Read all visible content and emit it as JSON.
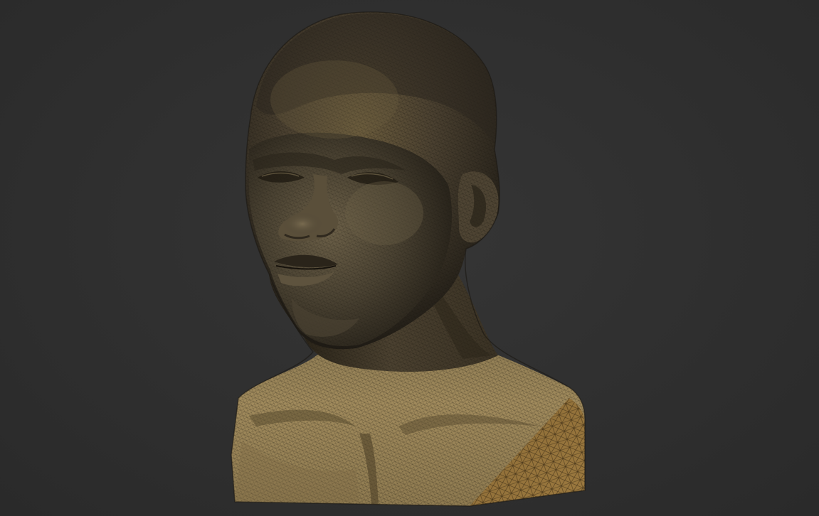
{
  "viewport": {
    "background_color": "#2f2f2f",
    "mesh_color_dark": "#3a3428",
    "mesh_color_light": "#a8915f",
    "wire_color": "#1e1a12"
  },
  "model": {
    "subject": "bust-mesh",
    "display_mode": "wireframe-shaded"
  }
}
